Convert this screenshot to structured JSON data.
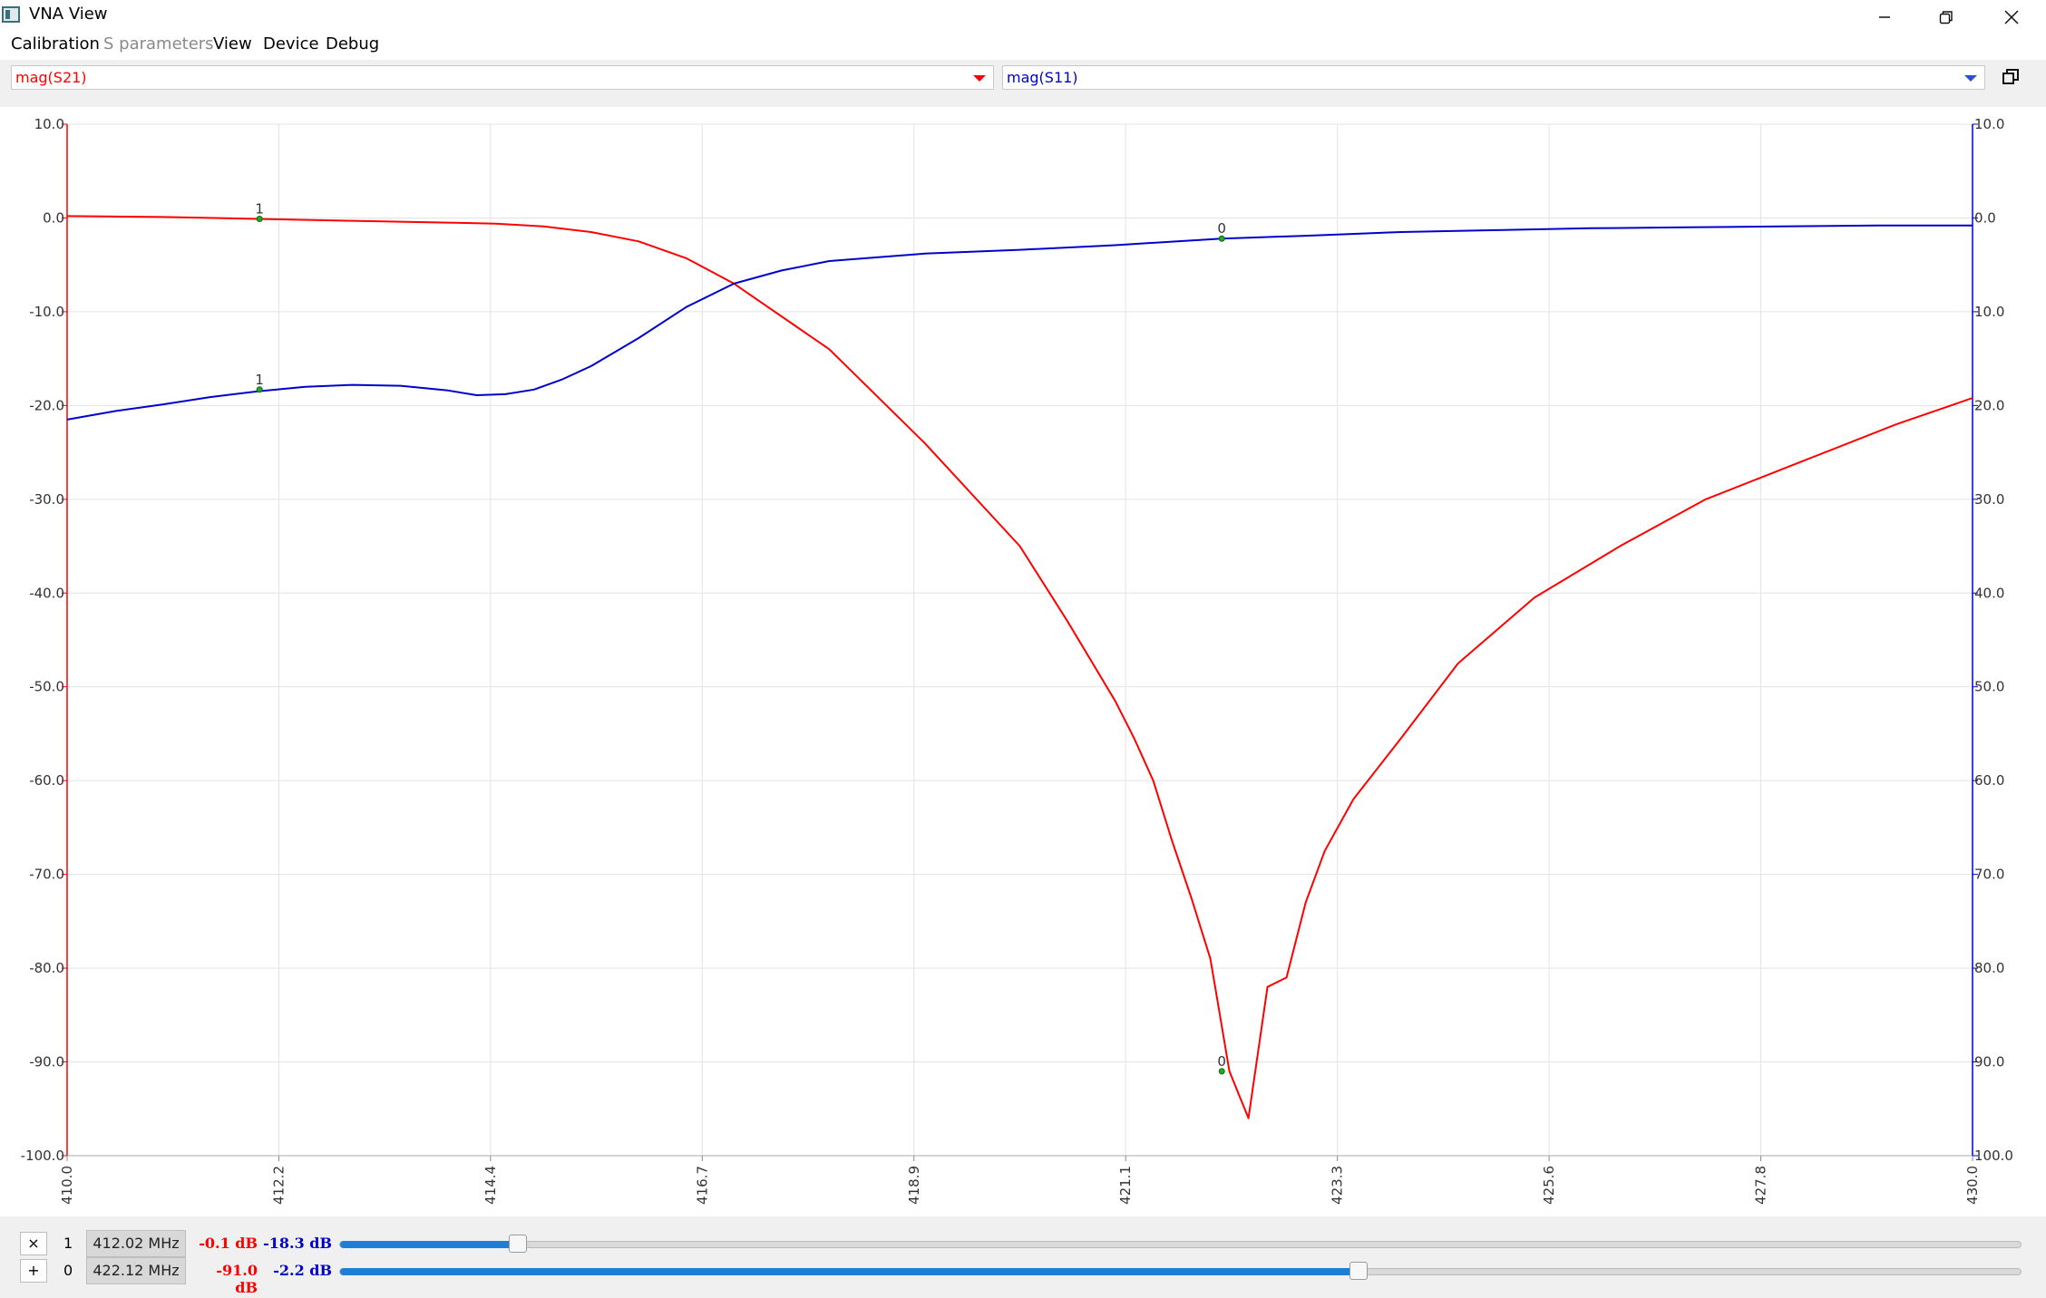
{
  "window": {
    "title": "VNA View"
  },
  "menu": [
    {
      "label": "Calibration",
      "enabled": true
    },
    {
      "label": "S parameters",
      "enabled": false
    },
    {
      "label": "View",
      "enabled": true
    },
    {
      "label": "Device",
      "enabled": true
    },
    {
      "label": "Debug",
      "enabled": true
    }
  ],
  "traces": {
    "left": {
      "label": "mag(S21)",
      "color": "#ff0000"
    },
    "right": {
      "label": "mag(S11)",
      "color": "#0000cc"
    }
  },
  "icons": {
    "app": "app-icon",
    "minimize": "minimize-icon",
    "maximize": "restore-window-icon",
    "close": "close-icon",
    "undock": "restore-icon"
  },
  "chart_data": {
    "type": "line",
    "title": "",
    "xlabel": "",
    "ylabel": "",
    "xlim": [
      410.0,
      430.0
    ],
    "ylim": [
      -100.0,
      10.0
    ],
    "x_ticks": [
      "410.0",
      "412.2",
      "414.4",
      "416.7",
      "418.9",
      "421.1",
      "423.3",
      "425.6",
      "427.8",
      "430.0"
    ],
    "y_ticks_left": [
      "10.0",
      "0.0",
      "-10.0",
      "-20.0",
      "-30.0",
      "-40.0",
      "-50.0",
      "-60.0",
      "-70.0",
      "-80.0",
      "-90.0",
      "-100.0"
    ],
    "y_ticks_right": [
      "10.0",
      "0.0",
      "10.0",
      "20.0",
      "30.0",
      "40.0",
      "50.0",
      "60.0",
      "70.0",
      "80.0",
      "90.0",
      "100.0"
    ],
    "grid": true,
    "series": [
      {
        "name": "mag(S21)",
        "color": "#ff0000",
        "axis": "left",
        "points": [
          [
            410.0,
            0.2
          ],
          [
            411.0,
            0.1
          ],
          [
            412.0,
            -0.1
          ],
          [
            413.0,
            -0.3
          ],
          [
            414.0,
            -0.5
          ],
          [
            414.5,
            -0.6
          ],
          [
            415.0,
            -0.9
          ],
          [
            415.5,
            -1.5
          ],
          [
            416.0,
            -2.5
          ],
          [
            416.5,
            -4.3
          ],
          [
            417.0,
            -7.0
          ],
          [
            418.0,
            -14.0
          ],
          [
            419.0,
            -24.0
          ],
          [
            420.0,
            -35.0
          ],
          [
            420.5,
            -43.0
          ],
          [
            421.0,
            -51.5
          ],
          [
            421.2,
            -55.5
          ],
          [
            421.4,
            -60.0
          ],
          [
            421.6,
            -66.5
          ],
          [
            421.8,
            -72.5
          ],
          [
            422.0,
            -79.0
          ],
          [
            422.2,
            -91.0
          ],
          [
            422.4,
            -96.0
          ],
          [
            422.6,
            -82.0
          ],
          [
            422.8,
            -81.0
          ],
          [
            423.0,
            -73.0
          ],
          [
            423.2,
            -67.5
          ],
          [
            423.5,
            -62.0
          ],
          [
            424.0,
            -55.5
          ],
          [
            424.6,
            -47.5
          ],
          [
            425.4,
            -40.5
          ],
          [
            426.3,
            -35.0
          ],
          [
            427.2,
            -30.0
          ],
          [
            428.2,
            -26.0
          ],
          [
            429.2,
            -22.0
          ],
          [
            430.0,
            -19.2
          ]
        ]
      },
      {
        "name": "mag(S11)",
        "color": "#0000cc",
        "axis": "left",
        "points": [
          [
            410.0,
            -21.5
          ],
          [
            410.5,
            -20.6
          ],
          [
            411.0,
            -19.9
          ],
          [
            411.5,
            -19.1
          ],
          [
            412.0,
            -18.5
          ],
          [
            412.5,
            -18.0
          ],
          [
            413.0,
            -17.8
          ],
          [
            413.5,
            -17.9
          ],
          [
            414.0,
            -18.4
          ],
          [
            414.3,
            -18.9
          ],
          [
            414.6,
            -18.8
          ],
          [
            414.9,
            -18.3
          ],
          [
            415.2,
            -17.2
          ],
          [
            415.5,
            -15.8
          ],
          [
            416.0,
            -12.8
          ],
          [
            416.5,
            -9.5
          ],
          [
            417.0,
            -7.0
          ],
          [
            417.5,
            -5.6
          ],
          [
            418.0,
            -4.6
          ],
          [
            419.0,
            -3.8
          ],
          [
            420.0,
            -3.4
          ],
          [
            421.0,
            -2.9
          ],
          [
            422.12,
            -2.2
          ],
          [
            423.0,
            -1.9
          ],
          [
            424.0,
            -1.5
          ],
          [
            425.0,
            -1.3
          ],
          [
            426.0,
            -1.1
          ],
          [
            427.0,
            -1.0
          ],
          [
            428.0,
            -0.9
          ],
          [
            429.0,
            -0.8
          ],
          [
            430.0,
            -0.8
          ]
        ]
      }
    ],
    "markers": [
      {
        "id": "1",
        "freq": 412.02,
        "s21": -0.1,
        "s11": -18.3
      },
      {
        "id": "0",
        "freq": 422.12,
        "s21": -91.0,
        "s11": -2.2
      }
    ]
  },
  "marker_panel": {
    "rows": [
      {
        "button": "×",
        "id": "1",
        "freq_label": "412.02 MHz",
        "s21_label": "-0.1 dB",
        "s11_label": "-18.3 dB",
        "position": 0.106
      },
      {
        "button": "+",
        "id": "0",
        "freq_label": "422.12 MHz",
        "s21_label": "-91.0 dB",
        "s11_label": "-2.2 dB",
        "position": 0.606
      }
    ]
  }
}
